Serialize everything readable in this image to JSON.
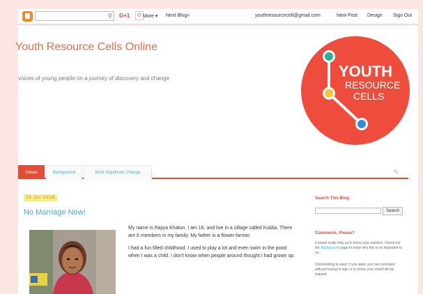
{
  "navbar": {
    "search_icon": "magnifier-icon",
    "gplus_label": "G+1",
    "gplus_count": "0",
    "more_label": "More ▾",
    "next_blog_label": "Next Blog»",
    "email": "youthresourcecell@gmail.com",
    "new_post_label": "New Post",
    "design_label": "Design",
    "sign_out_label": "Sign Out"
  },
  "header": {
    "title": "Youth Resource Cells Online",
    "description": "voices of young people on a journey of discovery and change",
    "logo": {
      "line1": "YOUTH",
      "line2": "RESOURCE",
      "line3": "CELLS"
    }
  },
  "tabs": [
    {
      "label": "Voices"
    },
    {
      "label": "Background"
    },
    {
      "label": "Most Significant Change"
    }
  ],
  "post": {
    "date": "29 Jul 2016",
    "title": "No Marriage Now!",
    "paragraph1": "My name is Rajiya Khatun. I am 16, and live in a village called Kuldia. There are 6 members in my family. My father is a flower-farmer.",
    "paragraph2": "I had a fun filled childhood. I used to play a lot and even swim in the pond when I was a child. I don't know when people around thought I had grown up."
  },
  "sidebar": {
    "search_title": "Search This Blog",
    "search_button": "Search",
    "comments_title": "Comments, Please?",
    "comments_p1": "It would really help us to know your reaction. Check out the",
    "comments_link": "Background",
    "comments_p1_end": "page to know why this is so important to us.",
    "comments_p2": "Commenting is easy! If you want, you can comment without having to sign in or share your email! All we request"
  },
  "colors": {
    "accent": "#e34c36",
    "link": "#44a9d6",
    "title": "#e86d4a",
    "background": "#fbe6e3",
    "date_badge": "#f6ed85"
  }
}
